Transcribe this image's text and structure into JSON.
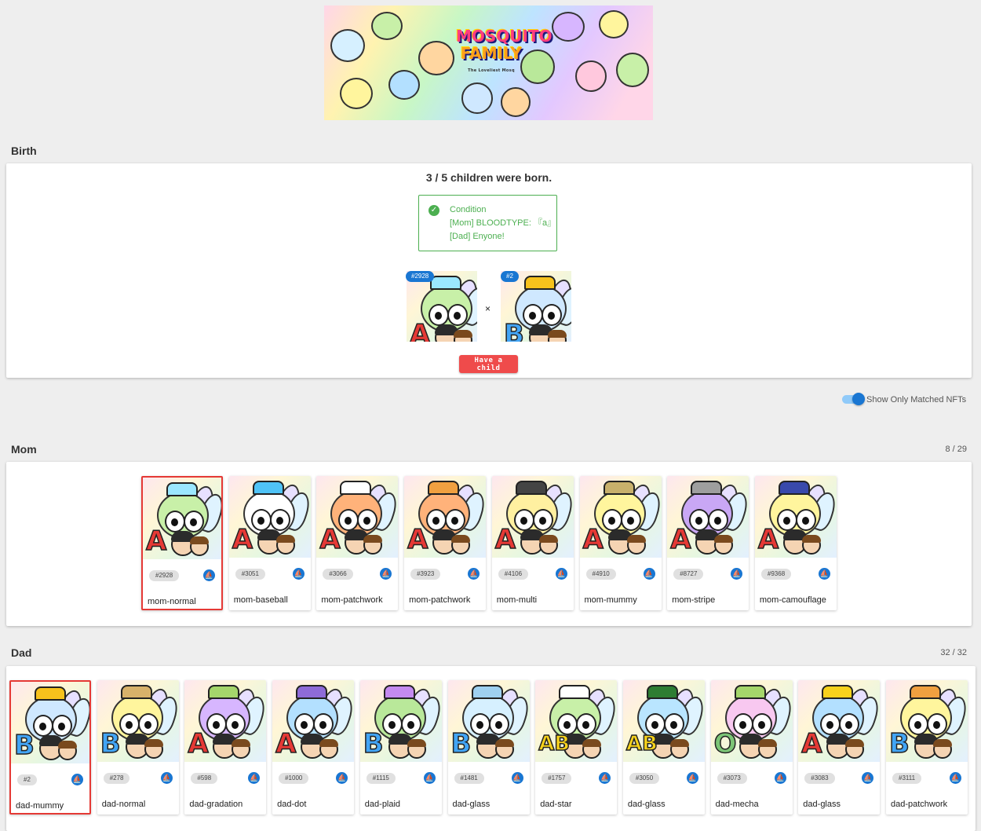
{
  "banner": {
    "logo_line1": "MOSQUITO",
    "logo_line2": "FAMILY",
    "tagline": "The Loveliest Mosq"
  },
  "birth": {
    "title": "Birth",
    "status": "3 / 5 children were born.",
    "condition": {
      "title": "Condition",
      "mom": "[Mom] BLOODTYPE: 『a』",
      "dad": "[Dad] Enyone!"
    },
    "mom_id": "#2928",
    "dad_id": "#2",
    "times": "×",
    "button": "Have a child"
  },
  "toggle": {
    "label": "Show Only Matched NFTs",
    "on": true
  },
  "mom": {
    "title": "Mom",
    "count": "8 / 29",
    "items": [
      {
        "id": "#2928",
        "name": "mom-normal",
        "selected": true,
        "letter": "A",
        "body": "#c8f0a8",
        "acc": "#9be7ff"
      },
      {
        "id": "#3051",
        "name": "mom-baseball",
        "selected": false,
        "letter": "A",
        "body": "#ffffff",
        "acc": "#4fc3f7"
      },
      {
        "id": "#3066",
        "name": "mom-patchwork",
        "selected": false,
        "letter": "A",
        "body": "#ffb27a",
        "acc": "#ffffff"
      },
      {
        "id": "#3923",
        "name": "mom-patchwork",
        "selected": false,
        "letter": "A",
        "body": "#ffb27a",
        "acc": "#f0a040"
      },
      {
        "id": "#4106",
        "name": "mom-multi",
        "selected": false,
        "letter": "A",
        "body": "#fff0a0",
        "acc": "#444444"
      },
      {
        "id": "#4910",
        "name": "mom-mummy",
        "selected": false,
        "letter": "A",
        "body": "#fff59d",
        "acc": "#c8b06b"
      },
      {
        "id": "#8727",
        "name": "mom-stripe",
        "selected": false,
        "letter": "A",
        "body": "#c9a7f5",
        "acc": "#9e9e9e"
      },
      {
        "id": "#9368",
        "name": "mom-camouflage",
        "selected": false,
        "letter": "A",
        "body": "#fff59d",
        "acc": "#3949ab"
      }
    ]
  },
  "dad": {
    "title": "Dad",
    "count": "32 / 32",
    "items": [
      {
        "id": "#2",
        "name": "dad-mummy",
        "selected": true,
        "letter": "B",
        "body": "#cfe8ff",
        "acc": "#f7c21c"
      },
      {
        "id": "#278",
        "name": "dad-normal",
        "selected": false,
        "letter": "B",
        "body": "#fff59d",
        "acc": "#d8b26a"
      },
      {
        "id": "#598",
        "name": "dad-gradation",
        "selected": false,
        "letter": "A",
        "body": "#d7b6ff",
        "acc": "#a5d66b"
      },
      {
        "id": "#1000",
        "name": "dad-dot",
        "selected": false,
        "letter": "A",
        "body": "#b3e0ff",
        "acc": "#8e6bd8"
      },
      {
        "id": "#1115",
        "name": "dad-plaid",
        "selected": false,
        "letter": "B",
        "body": "#b9e89a",
        "acc": "#c48af0"
      },
      {
        "id": "#1481",
        "name": "dad-glass",
        "selected": false,
        "letter": "B",
        "body": "#d6f0ff",
        "acc": "#9fd0f0"
      },
      {
        "id": "#1757",
        "name": "dad-star",
        "selected": false,
        "letter": "AB",
        "body": "#c8f0a8",
        "acc": "#ffffff"
      },
      {
        "id": "#3050",
        "name": "dad-glass",
        "selected": false,
        "letter": "AB",
        "body": "#b9e5ff",
        "acc": "#2e7d32"
      },
      {
        "id": "#3073",
        "name": "dad-mecha",
        "selected": false,
        "letter": "O",
        "body": "#f8c8f0",
        "acc": "#a5d66b"
      },
      {
        "id": "#3083",
        "name": "dad-glass",
        "selected": false,
        "letter": "A",
        "body": "#b3e0ff",
        "acc": "#f7d21c"
      },
      {
        "id": "#3111",
        "name": "dad-patchwork",
        "selected": false,
        "letter": "B",
        "body": "#fff59d",
        "acc": "#f0a040"
      }
    ]
  },
  "colors": {
    "accent": "#1976d2",
    "danger": "#ef4b4b",
    "success": "#4caf50",
    "letter_A": "#e53935",
    "letter_B": "#42a5f5",
    "letter_AB": "#f7d21c",
    "letter_O": "#7cc576"
  },
  "icons": {
    "condition": "check-circle-icon",
    "download": "download-icon"
  }
}
